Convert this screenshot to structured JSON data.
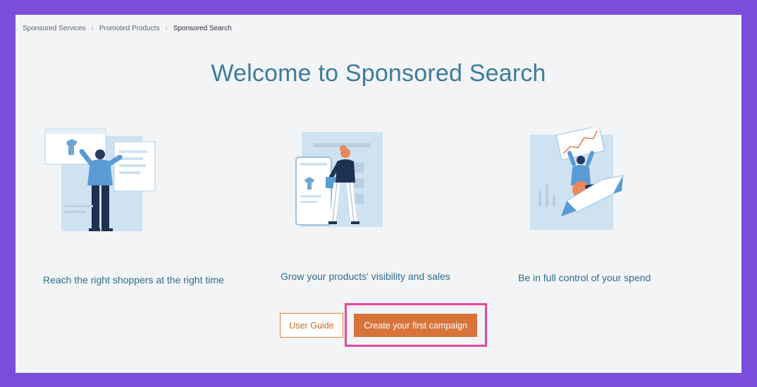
{
  "breadcrumb": {
    "items": [
      "Sponsored Services",
      "Promoted Products",
      "Sponsored Search"
    ]
  },
  "title": "Welcome to Sponsored Search",
  "features": [
    {
      "label": "Reach the right shoppers at the right time",
      "illustration": "person-at-screens-illustration"
    },
    {
      "label": "Grow your products' visibility and sales",
      "illustration": "shopper-with-bag-illustration"
    },
    {
      "label": "Be in full control of your spend",
      "illustration": "rocket-rider-illustration"
    }
  ],
  "actions": {
    "user_guide": "User Guide",
    "create_campaign": "Create your first campaign"
  },
  "colors": {
    "frame": "#7b4ddb",
    "title": "#3d7b9b",
    "accent": "#d8743a",
    "highlight": "#e8489a"
  }
}
